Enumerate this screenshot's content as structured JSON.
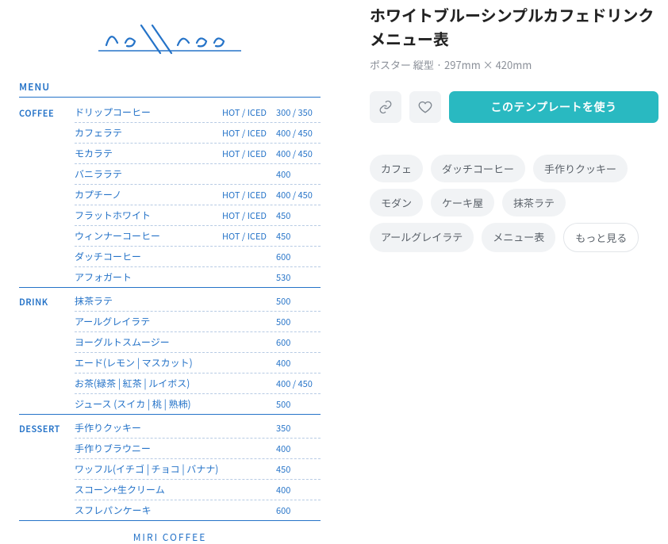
{
  "title": "ホワイトブルーシンプルカフェドリンクメニュー表",
  "meta": "ポスター 縦型 · 297mm × 420mm",
  "cta": "このテンプレートを使う",
  "menu_label": "MENU",
  "footer": "MIRI COFFEE",
  "logo": "coffee",
  "tags": [
    "カフェ",
    "ダッチコーヒー",
    "手作りクッキー",
    "モダン",
    "ケーキ屋",
    "抹茶ラテ",
    "アールグレイラテ",
    "メニュー表"
  ],
  "more": "もっと見る",
  "sections": [
    {
      "label": "COFFEE",
      "items": [
        {
          "name": "ドリップコーヒー",
          "temp": "HOT / ICED",
          "price": "300 / 350"
        },
        {
          "name": "カフェラテ",
          "temp": "HOT / ICED",
          "price": "400 / 450"
        },
        {
          "name": "モカラテ",
          "temp": "HOT / ICED",
          "price": "400 / 450"
        },
        {
          "name": "バニララテ",
          "temp": "",
          "price": "400"
        },
        {
          "name": "カプチーノ",
          "temp": "HOT / ICED",
          "price": "400 / 450"
        },
        {
          "name": "フラットホワイト",
          "temp": "HOT / ICED",
          "price": "450"
        },
        {
          "name": "ウィンナーコーヒー",
          "temp": "HOT / ICED",
          "price": "450"
        },
        {
          "name": "ダッチコーヒー",
          "temp": "",
          "price": "600"
        },
        {
          "name": "アフォガート",
          "temp": "",
          "price": "530"
        }
      ]
    },
    {
      "label": "DRINK",
      "items": [
        {
          "name": "抹茶ラテ",
          "temp": "",
          "price": "500"
        },
        {
          "name": "アールグレイラテ",
          "temp": "",
          "price": "500"
        },
        {
          "name": "ヨーグルトスムージー",
          "temp": "",
          "price": "600"
        },
        {
          "name": "エード(レモン | マスカット)",
          "temp": "",
          "price": "400"
        },
        {
          "name": "お茶(緑茶 | 紅茶 | ルイボス)",
          "temp": "",
          "price": "400 / 450"
        },
        {
          "name": "ジュース (スイカ |  桃 |  熟柿)",
          "temp": "",
          "price": "500"
        }
      ]
    },
    {
      "label": "DESSERT",
      "items": [
        {
          "name": "手作りクッキー",
          "temp": "",
          "price": "350"
        },
        {
          "name": "手作りブラウニー",
          "temp": "",
          "price": "400"
        },
        {
          "name": "ワッフル(イチゴ | チョコ | バナナ)",
          "temp": "",
          "price": "450"
        },
        {
          "name": "スコーン+生クリーム",
          "temp": "",
          "price": "400"
        },
        {
          "name": "スフレパンケーキ",
          "temp": "",
          "price": "600"
        }
      ]
    }
  ]
}
